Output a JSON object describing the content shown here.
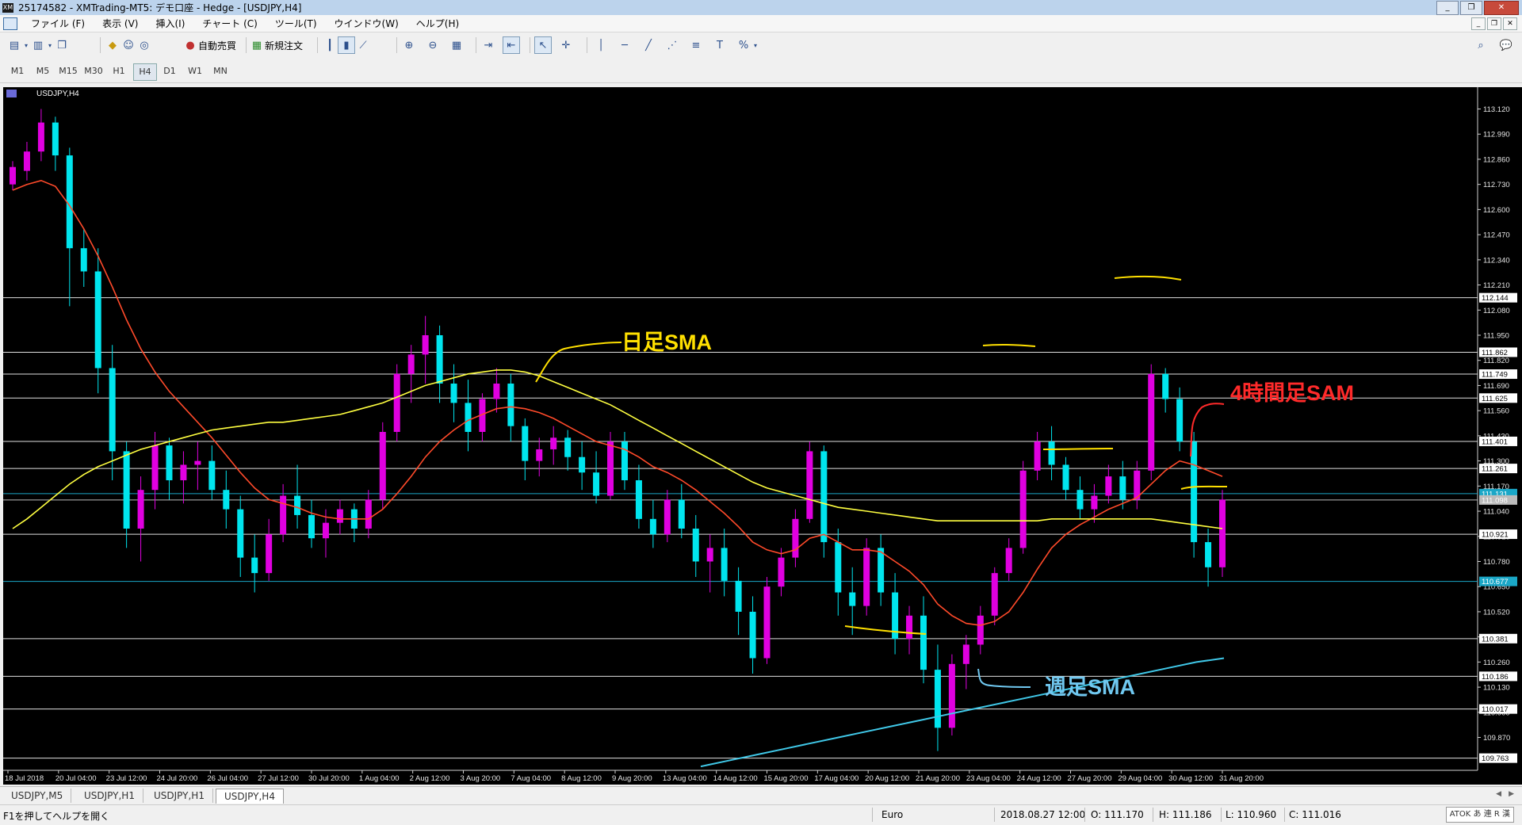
{
  "window": {
    "title": "25174582 - XMTrading-MT5: デモ口座 - Hedge - [USDJPY,H4]",
    "buttons": [
      "_",
      "❐",
      "✕"
    ]
  },
  "menu": {
    "items": [
      "ファイル (F)",
      "表示 (V)",
      "挿入(I)",
      "チャート (C)",
      "ツール(T)",
      "ウインドウ(W)",
      "ヘルプ(H)"
    ]
  },
  "toolbar": {
    "auto_trade_label": "自動売買",
    "new_order_label": "新規注文"
  },
  "timeframes": {
    "items": [
      "M1",
      "M5",
      "M15",
      "M30",
      "H1",
      "H4",
      "D1",
      "W1",
      "MN"
    ],
    "active": "H4"
  },
  "chart": {
    "symbol_label": "USDJPY,H4",
    "colors": {
      "background": "#000000",
      "bull": "#e000e0",
      "bear": "#00e5ee",
      "h4_sma": "#ff4a2a",
      "daily_sma": "#ffff40",
      "weekly_sma": "#40c8e8",
      "hlines": "#e0e0e0",
      "annot_yellow": "#ffe000",
      "annot_red": "#ff2a2a",
      "annot_blue": "#70c8f0"
    },
    "annotations": {
      "daily": "日足SMA",
      "h4": "4時間足SAM",
      "weekly": "週足SMA"
    }
  },
  "chart_data": {
    "type": "candlestick",
    "symbol": "USDJPY",
    "timeframe": "H4",
    "ylim": [
      109.7,
      113.2
    ],
    "y_ticks": [
      113.12,
      112.99,
      112.86,
      112.73,
      112.6,
      112.47,
      112.34,
      112.21,
      112.08,
      111.95,
      111.82,
      111.69,
      111.56,
      111.43,
      111.3,
      111.17,
      111.04,
      110.91,
      110.78,
      110.65,
      110.52,
      110.39,
      110.26,
      110.13,
      110.0,
      109.87
    ],
    "y_tick_labels": [
      "113.120",
      "112.990",
      "112.860",
      "112.730",
      "112.600",
      "112.470",
      "112.340",
      "112.210",
      "112.080",
      "111.950",
      "111.820",
      "111.690",
      "111.560",
      "111.430",
      "111.300",
      "111.170",
      "111.040",
      "110.910",
      "110.780",
      "110.650",
      "110.520",
      "110.390",
      "110.260",
      "110.130",
      "110.000",
      "109.870"
    ],
    "x_labels": [
      "18 Jul 2018",
      "20 Jul 04:00",
      "23 Jul 12:00",
      "24 Jul 20:00",
      "26 Jul 04:00",
      "27 Jul 12:00",
      "30 Jul 20:00",
      "1 Aug 04:00",
      "2 Aug 12:00",
      "3 Aug 20:00",
      "7 Aug 04:00",
      "8 Aug 12:00",
      "9 Aug 20:00",
      "13 Aug 04:00",
      "14 Aug 12:00",
      "15 Aug 20:00",
      "17 Aug 04:00",
      "20 Aug 12:00",
      "21 Aug 20:00",
      "23 Aug 04:00",
      "24 Aug 12:00",
      "27 Aug 20:00",
      "29 Aug 04:00",
      "30 Aug 12:00",
      "31 Aug 20:00"
    ],
    "horizontal_levels": [
      {
        "price": 112.144,
        "label": "112.144"
      },
      {
        "price": 111.862,
        "label": "111.862"
      },
      {
        "price": 111.749,
        "label": "111.749"
      },
      {
        "price": 111.625,
        "label": "111.625"
      },
      {
        "price": 111.401,
        "label": "111.401"
      },
      {
        "price": 111.261,
        "label": "111.261"
      },
      {
        "price": 110.921,
        "label": "110.921"
      },
      {
        "price": 110.381,
        "label": "110.381"
      },
      {
        "price": 110.186,
        "label": "110.186"
      },
      {
        "price": 110.017,
        "label": "110.017"
      },
      {
        "price": 109.763,
        "label": "109.763"
      }
    ],
    "price_marks": [
      {
        "price": 111.131,
        "label": "111.131",
        "color": "#1aa7c7"
      },
      {
        "price": 111.098,
        "label": "111.098",
        "color": "#bbbbbb"
      },
      {
        "price": 110.677,
        "label": "110.677",
        "color": "#1aa7c7"
      }
    ],
    "candles": [
      [
        112.73,
        112.85,
        112.7,
        112.82
      ],
      [
        112.8,
        112.95,
        112.75,
        112.9
      ],
      [
        112.9,
        113.12,
        112.85,
        113.05
      ],
      [
        113.05,
        113.08,
        112.8,
        112.88
      ],
      [
        112.88,
        112.92,
        112.1,
        112.4
      ],
      [
        112.4,
        112.5,
        112.2,
        112.28
      ],
      [
        112.28,
        112.4,
        111.65,
        111.78
      ],
      [
        111.78,
        111.9,
        111.2,
        111.35
      ],
      [
        111.35,
        111.4,
        110.85,
        110.95
      ],
      [
        110.95,
        111.22,
        110.78,
        111.15
      ],
      [
        111.15,
        111.45,
        111.05,
        111.38
      ],
      [
        111.38,
        111.42,
        111.1,
        111.2
      ],
      [
        111.2,
        111.35,
        111.08,
        111.28
      ],
      [
        111.28,
        111.4,
        111.15,
        111.3
      ],
      [
        111.3,
        111.38,
        111.1,
        111.15
      ],
      [
        111.15,
        111.25,
        110.95,
        111.05
      ],
      [
        111.05,
        111.12,
        110.7,
        110.8
      ],
      [
        110.8,
        110.92,
        110.62,
        110.72
      ],
      [
        110.72,
        111.0,
        110.68,
        110.92
      ],
      [
        110.92,
        111.18,
        110.88,
        111.12
      ],
      [
        111.12,
        111.28,
        110.95,
        111.02
      ],
      [
        111.02,
        111.1,
        110.85,
        110.9
      ],
      [
        110.9,
        111.05,
        110.8,
        110.98
      ],
      [
        110.98,
        111.1,
        110.92,
        111.05
      ],
      [
        111.05,
        111.08,
        110.88,
        110.95
      ],
      [
        110.95,
        111.15,
        110.9,
        111.1
      ],
      [
        111.1,
        111.5,
        111.05,
        111.45
      ],
      [
        111.45,
        111.8,
        111.4,
        111.75
      ],
      [
        111.75,
        111.9,
        111.6,
        111.85
      ],
      [
        111.85,
        112.05,
        111.7,
        111.95
      ],
      [
        111.95,
        112.0,
        111.6,
        111.7
      ],
      [
        111.7,
        111.8,
        111.5,
        111.6
      ],
      [
        111.6,
        111.72,
        111.35,
        111.45
      ],
      [
        111.45,
        111.65,
        111.4,
        111.62
      ],
      [
        111.62,
        111.78,
        111.55,
        111.7
      ],
      [
        111.7,
        111.75,
        111.4,
        111.48
      ],
      [
        111.48,
        111.52,
        111.2,
        111.3
      ],
      [
        111.3,
        111.42,
        111.22,
        111.36
      ],
      [
        111.36,
        111.48,
        111.28,
        111.42
      ],
      [
        111.42,
        111.46,
        111.25,
        111.32
      ],
      [
        111.32,
        111.4,
        111.15,
        111.24
      ],
      [
        111.24,
        111.35,
        111.08,
        111.12
      ],
      [
        111.12,
        111.45,
        111.1,
        111.4
      ],
      [
        111.4,
        111.45,
        111.15,
        111.2
      ],
      [
        111.2,
        111.28,
        110.95,
        111.0
      ],
      [
        111.0,
        111.1,
        110.85,
        110.92
      ],
      [
        110.92,
        111.15,
        110.88,
        111.1
      ],
      [
        111.1,
        111.18,
        110.9,
        110.95
      ],
      [
        110.95,
        111.02,
        110.7,
        110.78
      ],
      [
        110.78,
        110.92,
        110.62,
        110.85
      ],
      [
        110.85,
        110.95,
        110.6,
        110.68
      ],
      [
        110.68,
        110.75,
        110.4,
        110.52
      ],
      [
        110.52,
        110.6,
        110.2,
        110.28
      ],
      [
        110.28,
        110.7,
        110.25,
        110.65
      ],
      [
        110.65,
        110.85,
        110.6,
        110.8
      ],
      [
        110.8,
        111.05,
        110.75,
        111.0
      ],
      [
        111.0,
        111.4,
        110.98,
        111.35
      ],
      [
        111.35,
        111.38,
        110.8,
        110.88
      ],
      [
        110.88,
        110.95,
        110.5,
        110.62
      ],
      [
        110.62,
        110.75,
        110.4,
        110.55
      ],
      [
        110.55,
        110.9,
        110.5,
        110.85
      ],
      [
        110.85,
        110.92,
        110.55,
        110.62
      ],
      [
        110.62,
        110.72,
        110.3,
        110.38
      ],
      [
        110.38,
        110.55,
        110.3,
        110.5
      ],
      [
        110.5,
        110.6,
        110.15,
        110.22
      ],
      [
        110.22,
        110.35,
        109.8,
        109.92
      ],
      [
        109.92,
        110.3,
        109.88,
        110.25
      ],
      [
        110.25,
        110.4,
        110.12,
        110.35
      ],
      [
        110.35,
        110.55,
        110.3,
        110.5
      ],
      [
        110.5,
        110.75,
        110.45,
        110.72
      ],
      [
        110.72,
        110.9,
        110.68,
        110.85
      ],
      [
        110.85,
        111.3,
        110.82,
        111.25
      ],
      [
        111.25,
        111.45,
        111.2,
        111.4
      ],
      [
        111.4,
        111.48,
        111.2,
        111.28
      ],
      [
        111.28,
        111.32,
        111.1,
        111.15
      ],
      [
        111.15,
        111.22,
        111.0,
        111.05
      ],
      [
        111.05,
        111.18,
        110.98,
        111.12
      ],
      [
        111.12,
        111.28,
        111.08,
        111.22
      ],
      [
        111.22,
        111.3,
        111.05,
        111.1
      ],
      [
        111.1,
        111.3,
        111.05,
        111.25
      ],
      [
        111.25,
        111.8,
        111.2,
        111.75
      ],
      [
        111.75,
        111.78,
        111.55,
        111.62
      ],
      [
        111.62,
        111.68,
        111.35,
        111.4
      ],
      [
        111.4,
        111.45,
        110.8,
        110.88
      ],
      [
        110.88,
        110.95,
        110.65,
        110.75
      ],
      [
        110.75,
        111.15,
        110.7,
        111.1
      ]
    ],
    "series": [
      {
        "name": "4時間足SAM",
        "color": "#ff4a2a",
        "values": [
          112.7,
          112.73,
          112.75,
          112.72,
          112.62,
          112.5,
          112.36,
          112.2,
          112.03,
          111.88,
          111.76,
          111.66,
          111.58,
          111.5,
          111.42,
          111.33,
          111.24,
          111.16,
          111.1,
          111.08,
          111.06,
          111.03,
          111.01,
          111.0,
          111.0,
          111.0,
          111.05,
          111.13,
          111.22,
          111.32,
          111.4,
          111.46,
          111.51,
          111.54,
          111.57,
          111.58,
          111.57,
          111.55,
          111.52,
          111.48,
          111.44,
          111.4,
          111.38,
          111.36,
          111.32,
          111.27,
          111.24,
          111.2,
          111.15,
          111.09,
          111.03,
          110.96,
          110.88,
          110.84,
          110.82,
          110.84,
          110.9,
          110.92,
          110.88,
          110.84,
          110.84,
          110.83,
          110.78,
          110.73,
          110.66,
          110.56,
          110.5,
          110.46,
          110.45,
          110.47,
          110.52,
          110.62,
          110.74,
          110.85,
          110.92,
          110.97,
          111.01,
          111.05,
          111.08,
          111.11,
          111.18,
          111.25,
          111.3,
          111.28,
          111.25,
          111.22
        ]
      },
      {
        "name": "日足SMA",
        "color": "#ffff40",
        "values": [
          110.95,
          111.0,
          111.06,
          111.12,
          111.18,
          111.23,
          111.27,
          111.3,
          111.33,
          111.36,
          111.38,
          111.4,
          111.42,
          111.44,
          111.46,
          111.47,
          111.48,
          111.49,
          111.5,
          111.5,
          111.51,
          111.52,
          111.53,
          111.54,
          111.56,
          111.58,
          111.6,
          111.63,
          111.66,
          111.69,
          111.71,
          111.73,
          111.75,
          111.76,
          111.77,
          111.77,
          111.76,
          111.74,
          111.71,
          111.68,
          111.65,
          111.62,
          111.59,
          111.55,
          111.51,
          111.47,
          111.43,
          111.39,
          111.35,
          111.31,
          111.27,
          111.23,
          111.19,
          111.16,
          111.14,
          111.12,
          111.1,
          111.08,
          111.06,
          111.05,
          111.04,
          111.03,
          111.02,
          111.01,
          111.0,
          110.99,
          110.99,
          110.99,
          110.99,
          110.99,
          110.99,
          110.99,
          110.99,
          111.0,
          111.0,
          111.0,
          111.0,
          111.0,
          111.0,
          111.0,
          111.0,
          110.99,
          110.98,
          110.97,
          110.96,
          110.95
        ]
      },
      {
        "name": "週足SMA",
        "color": "#40c8e8",
        "values": [
          109.72,
          109.75,
          109.78,
          109.81,
          109.84,
          109.87,
          109.9,
          109.93,
          109.96,
          109.99,
          110.02,
          110.05,
          110.08,
          110.11,
          110.14,
          110.17,
          110.2,
          110.23,
          110.26,
          110.28
        ]
      }
    ]
  },
  "tabs": {
    "items": [
      "USDJPY,M5",
      "USDJPY,H1",
      "USDJPY,H1",
      "USDJPY,H4"
    ],
    "active_index": 3
  },
  "status": {
    "help": "F1を押してヘルプを開く",
    "profile": "Euro",
    "datetime": "2018.08.27 12:00",
    "open": "O: 111.170",
    "high": "H: 111.186",
    "low": "L: 110.960",
    "close": "C: 111.016",
    "ime": "ATOK あ 連 R 漢"
  }
}
